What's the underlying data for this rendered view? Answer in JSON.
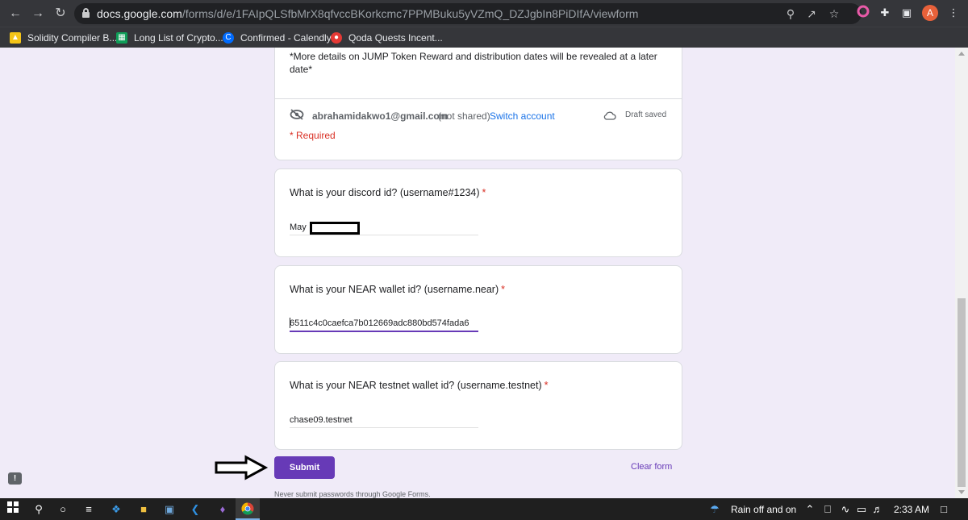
{
  "browser": {
    "url_host": "docs.google.com",
    "url_path": "/forms/d/e/1FAIpQLSfbMrX8qfvccBKorkcmc7PPMBuku5yVZmQ_DZJgbIn8PiDIfA/viewform",
    "profile_initial": "A",
    "bookmarks": [
      {
        "label": "Solidity Compiler B...",
        "icon": "solidity-icon",
        "color": "#f5c518"
      },
      {
        "label": "Long List of Crypto...",
        "icon": "sheets-icon",
        "color": "#0f9d58"
      },
      {
        "label": "Confirmed - Calendly",
        "icon": "calendly-icon",
        "color": "#006bff"
      },
      {
        "label": "Qoda Quests Incent...",
        "icon": "qoda-icon",
        "color": "#e53935"
      }
    ]
  },
  "form": {
    "description": "*More details on JUMP Token Reward and distribution dates will be revealed at a later date*",
    "account_email": "abrahamidakwo1@gmail.com",
    "not_shared": "(not shared)",
    "switch_account": "Switch account",
    "draft_saved": "Draft saved",
    "required_note": "* Required",
    "questions": [
      {
        "title": "What is your discord id? (username#1234)",
        "required_mark": "*",
        "value": "May"
      },
      {
        "title": "What is your NEAR wallet id? (username.near)",
        "required_mark": "*",
        "value": "6511c4c0caefca7b012669adc880bd574fada6"
      },
      {
        "title": "What is your NEAR testnet wallet id? (username.testnet)",
        "required_mark": "*",
        "value": "chase09.testnet"
      }
    ],
    "submit_label": "Submit",
    "clear_label": "Clear form",
    "footer_note": "Never submit passwords through Google Forms."
  },
  "taskbar": {
    "weather": "Rain off and on",
    "time": "2:33 AM"
  },
  "colors": {
    "accent": "#673ab7",
    "required": "#d93025",
    "link": "#1a73e8",
    "page_bg": "#f0ebf8"
  }
}
